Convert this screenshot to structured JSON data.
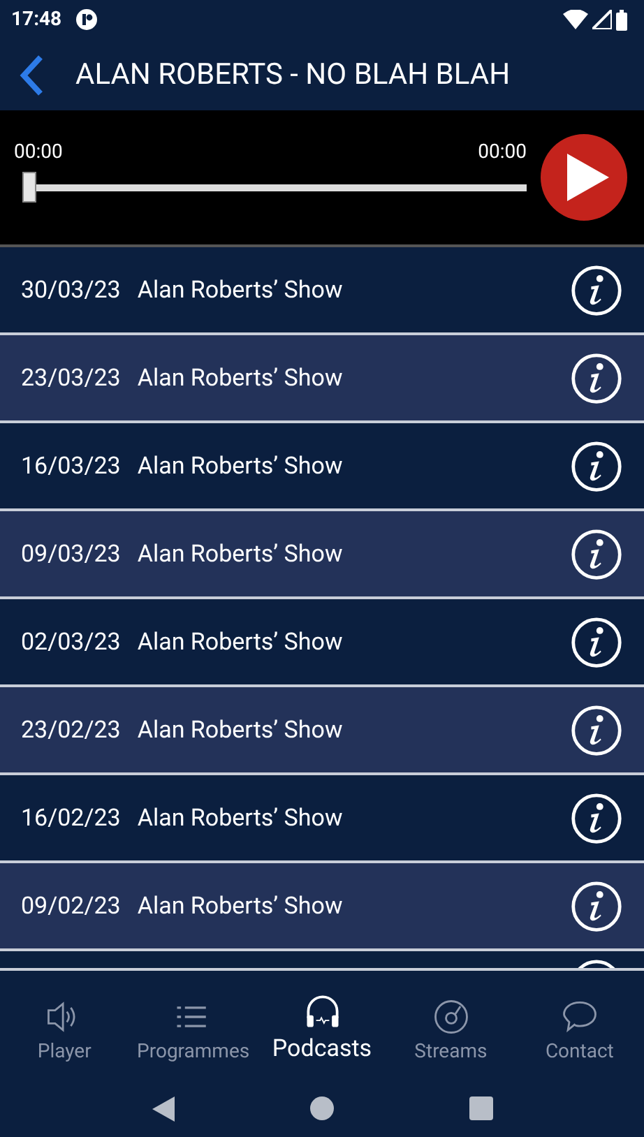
{
  "status_bar": {
    "time": "17:48"
  },
  "header": {
    "title": "ALAN ROBERTS - NO BLAH BLAH"
  },
  "player": {
    "elapsed": "00:00",
    "duration": "00:00",
    "level": 0
  },
  "episodes": [
    {
      "date": "30/03/23",
      "title": "Alan Roberts’ Show"
    },
    {
      "date": "23/03/23",
      "title": "Alan Roberts’ Show"
    },
    {
      "date": "16/03/23",
      "title": "Alan Roberts’ Show"
    },
    {
      "date": "09/03/23",
      "title": "Alan Roberts’ Show"
    },
    {
      "date": "02/03/23",
      "title": "Alan Roberts’ Show"
    },
    {
      "date": "23/02/23",
      "title": "Alan Roberts’ Show"
    },
    {
      "date": "16/02/23",
      "title": "Alan Roberts’ Show"
    },
    {
      "date": "09/02/23",
      "title": "Alan Roberts’ Show"
    }
  ],
  "tab_bar": [
    {
      "label": "Player",
      "selected": false
    },
    {
      "label": "Programmes",
      "selected": false
    },
    {
      "label": "Podcasts",
      "selected": true
    },
    {
      "label": "Streams",
      "selected": false
    },
    {
      "label": "Contact",
      "selected": false
    }
  ]
}
